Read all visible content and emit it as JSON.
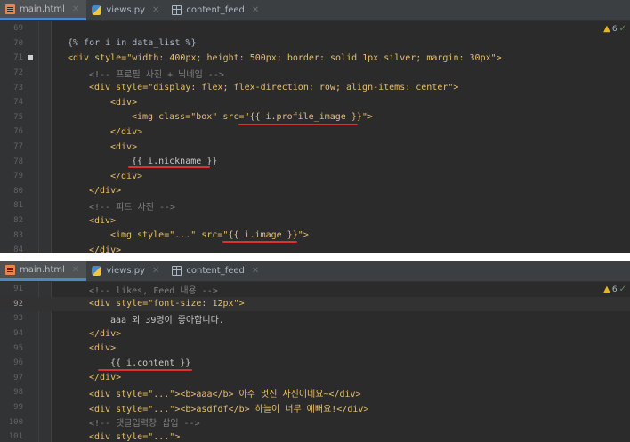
{
  "tabs": [
    {
      "label": "main.html",
      "icon": "html-file-icon",
      "active": true
    },
    {
      "label": "views.py",
      "icon": "python-file-icon",
      "active": false
    },
    {
      "label": "content_feed",
      "icon": "table-icon",
      "active": false
    }
  ],
  "inspection": {
    "warnings": "6"
  },
  "pane1": {
    "lines": [
      {
        "n": "69",
        "text": ""
      },
      {
        "n": "70",
        "text": "{% for i in data_list %}"
      },
      {
        "n": "71",
        "text": "<div style=\"width: 400px; height: 500px; border: solid 1px silver; margin: 30px\">"
      },
      {
        "n": "72",
        "text": "<!-- 프로필 사진 + 닉네임 -->"
      },
      {
        "n": "73",
        "text": "<div style=\"display: flex; flex-direction: row; align-items: center\">"
      },
      {
        "n": "74",
        "text": "<div>"
      },
      {
        "n": "75",
        "text": "<img class=\"box\" src=\"{{ i.profile_image }}\">"
      },
      {
        "n": "76",
        "text": "</div>"
      },
      {
        "n": "77",
        "text": "<div>"
      },
      {
        "n": "78",
        "text": "{{ i.nickname }}"
      },
      {
        "n": "79",
        "text": "</div>"
      },
      {
        "n": "80",
        "text": "</div>"
      },
      {
        "n": "81",
        "text": "<!-- 피드 사진 -->"
      },
      {
        "n": "82",
        "text": "<div>"
      },
      {
        "n": "83",
        "text": "<img style=\"...\" src=\"{{ i.image }}\">"
      },
      {
        "n": "84",
        "text": "</div>"
      }
    ]
  },
  "pane2": {
    "lines": [
      {
        "n": "91",
        "text": "<!-- likes, Feed 내용 -->"
      },
      {
        "n": "92",
        "text": "<div style=\"font-size: 12px\">"
      },
      {
        "n": "93",
        "text": "aaa 외 39명이 좋아합니다."
      },
      {
        "n": "94",
        "text": "</div>"
      },
      {
        "n": "95",
        "text": "<div>"
      },
      {
        "n": "96",
        "text": "{{ i.content }}"
      },
      {
        "n": "97",
        "text": "</div>"
      },
      {
        "n": "98",
        "text": "<div style=\"...\"><b>aaa</b> 아주 멋진 사진이네요~</div>"
      },
      {
        "n": "99",
        "text": "<div style=\"...\"><b>asdfdf</b> 하늘이 너무 예뻐요!</div>"
      },
      {
        "n": "100",
        "text": "<!-- 댓글입력창 삽입 -->"
      },
      {
        "n": "101",
        "text": "<div style=\"...\">"
      }
    ]
  },
  "colors": {
    "editor_bg": "#2b2b2b",
    "gutter_bg": "#313335",
    "tag": "#e8bf6a",
    "string": "#a5c25c",
    "template": "#cc7832",
    "comment": "#808080",
    "annotation_underline": "#e03030"
  }
}
